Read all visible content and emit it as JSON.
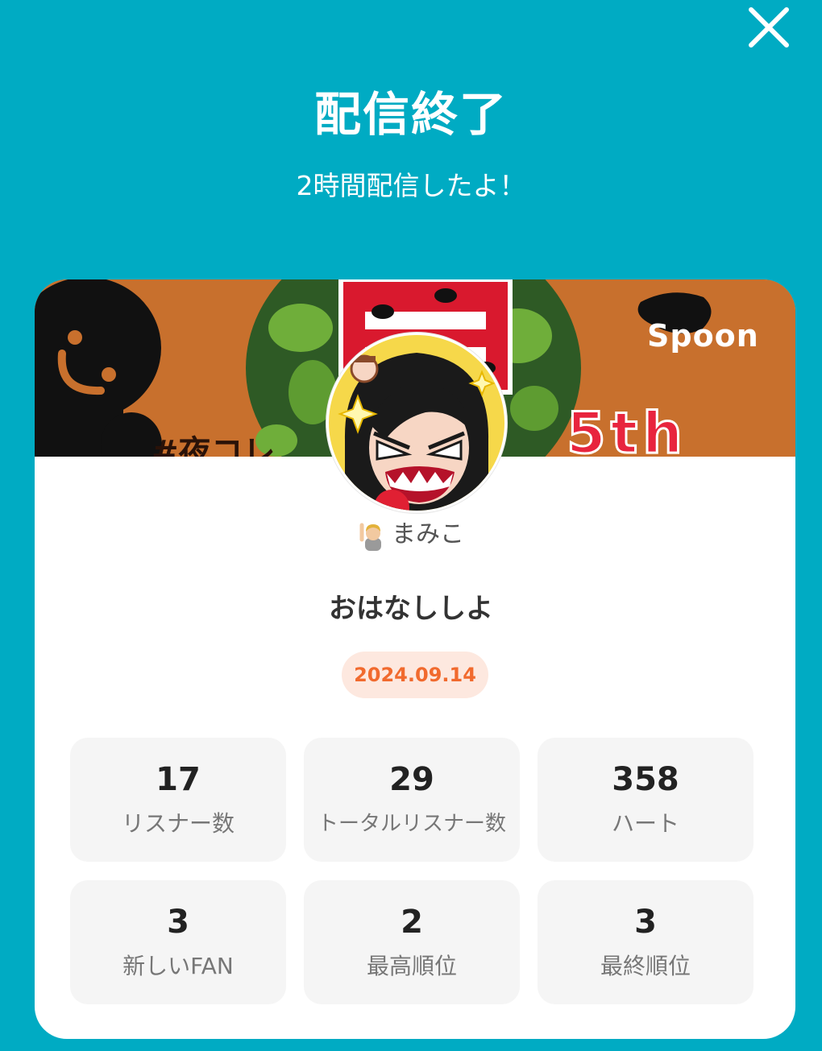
{
  "header": {
    "title": "配信終了",
    "subtitle": "2時間配信したよ！"
  },
  "banner": {
    "brand": "Spoon",
    "hashtag": "#夜コレ",
    "badge_text": "5th"
  },
  "host": {
    "name": "まみこ",
    "badge_icon": "raising-hand-person-icon"
  },
  "live": {
    "title": "おはなししよ",
    "date": "2024.09.14"
  },
  "stats": [
    {
      "value": "17",
      "label": "リスナー数"
    },
    {
      "value": "29",
      "label": "トータルリスナー数"
    },
    {
      "value": "358",
      "label": "ハート"
    },
    {
      "value": "3",
      "label": "新しいFAN"
    },
    {
      "value": "2",
      "label": "最高順位"
    },
    {
      "value": "3",
      "label": "最終順位"
    }
  ],
  "colors": {
    "background": "#00abc3",
    "card": "#ffffff",
    "banner": "#c8702d",
    "date_badge_bg": "#fde8df",
    "date_badge_text": "#f16a2e",
    "stat_bg": "#f5f5f5"
  }
}
